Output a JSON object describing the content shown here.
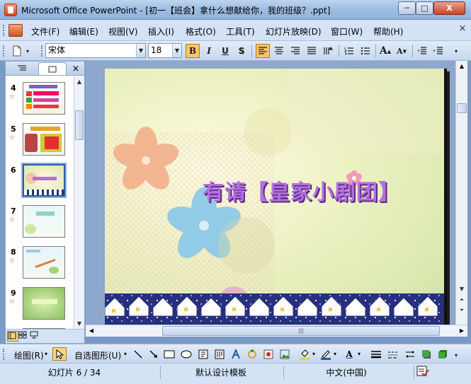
{
  "window": {
    "title": "Microsoft Office PowerPoint - [初一【班会】拿什么想献给你，我的班级？.ppt]",
    "minimize_glyph": "─",
    "maximize_glyph": "□",
    "close_glyph": "X"
  },
  "menu": {
    "items": [
      "文件(F)",
      "编辑(E)",
      "视图(V)",
      "插入(I)",
      "格式(O)",
      "工具(T)",
      "幻灯片放映(D)",
      "窗口(W)",
      "帮助(H)"
    ]
  },
  "toolbar": {
    "font_name": "宋体",
    "font_size": "18",
    "bold_label": "B",
    "italic_label": "I",
    "underline_label": "U",
    "shadow_label": "S",
    "grow_font_label": "A",
    "shrink_font_label": "A"
  },
  "slides_pane": {
    "tabs": [
      "outline-tab",
      "slides-tab"
    ],
    "close_glyph": "×",
    "thumbnails": [
      {
        "number": "4"
      },
      {
        "number": "5"
      },
      {
        "number": "6"
      },
      {
        "number": "7"
      },
      {
        "number": "8"
      },
      {
        "number": "9"
      },
      {
        "number": ""
      }
    ],
    "selected_number": "6"
  },
  "slide": {
    "title_text": "有请【皇家小剧团】"
  },
  "drawing_toolbar": {
    "draw_label": "绘图(R)",
    "autoshapes_label": "自选图形(U)"
  },
  "status": {
    "slide_position": "幻灯片 6 / 34",
    "design_template": "默认设计模板",
    "language": "中文(中国)"
  }
}
